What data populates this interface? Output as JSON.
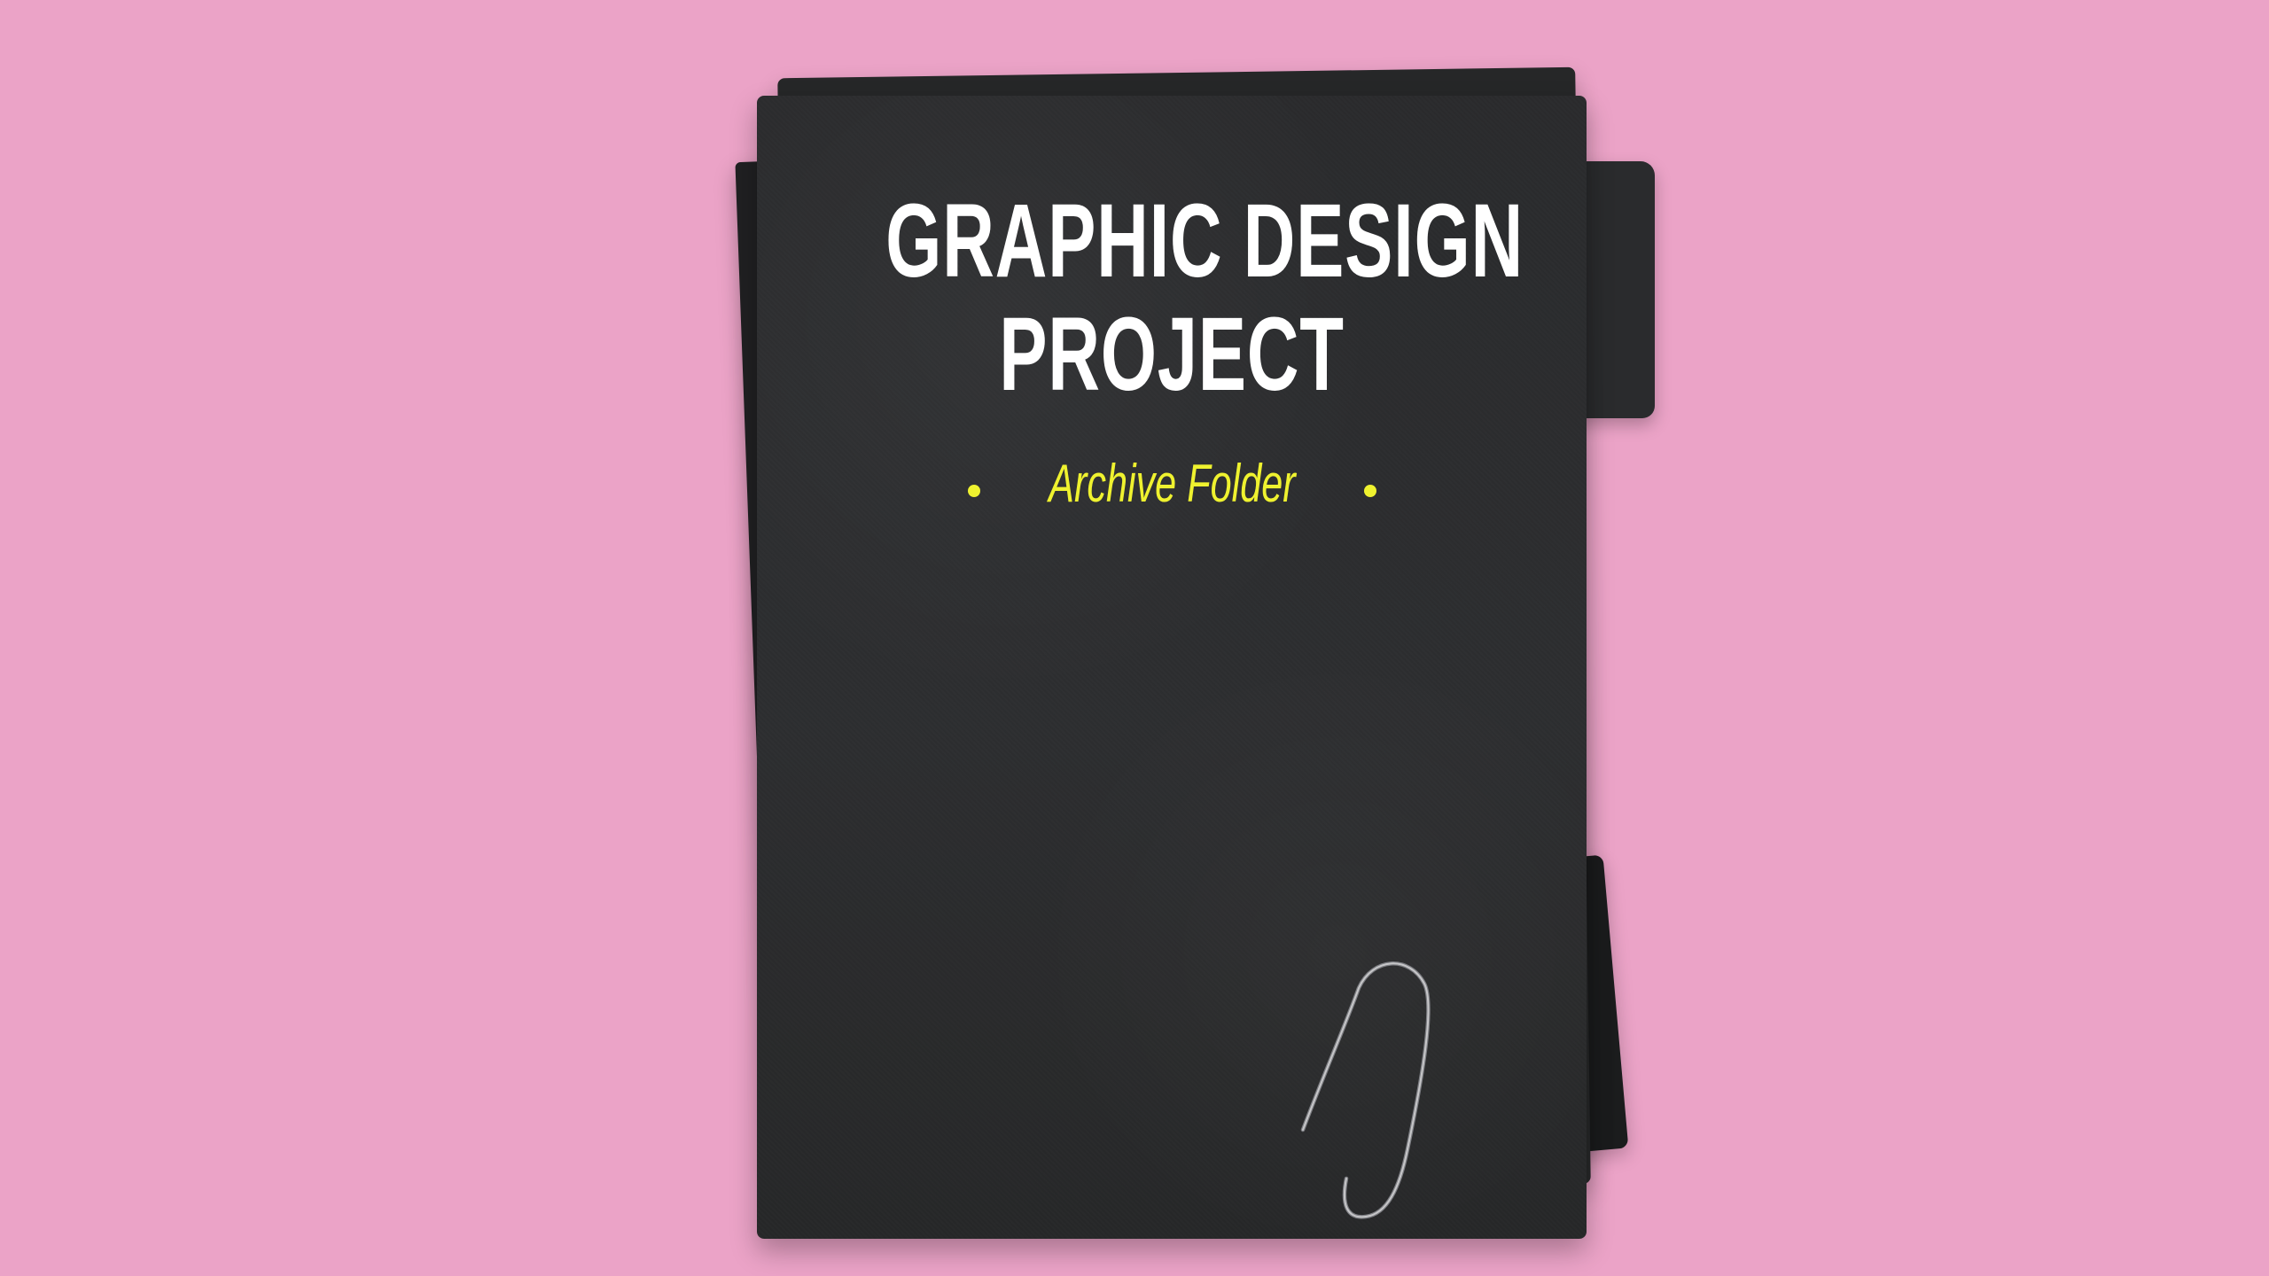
{
  "background_color": "#eba3c7",
  "folder": {
    "title_line_1": "GRAPHIC DESIGN",
    "title_line_2": "PROJECT",
    "subtitle": "Archive Folder",
    "accent_color": "#eff22f"
  },
  "icons": {
    "paperclip": "paperclip-icon",
    "bullet_left": "bullet-dot-icon",
    "bullet_right": "bullet-dot-icon"
  }
}
